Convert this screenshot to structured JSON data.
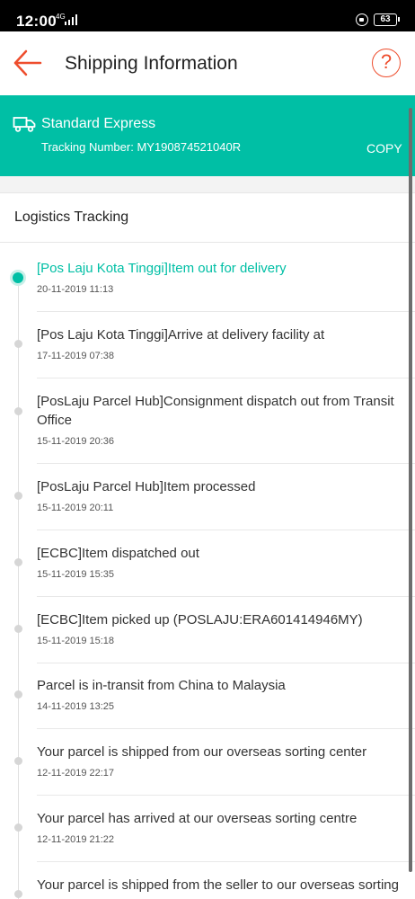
{
  "status_bar": {
    "time": "12:00",
    "network": "4G",
    "battery": "63"
  },
  "header": {
    "title": "Shipping Information",
    "back_icon": "arrow-left-icon",
    "help_icon": "question-icon",
    "help_label": "?"
  },
  "shipping": {
    "carrier": "Standard Express",
    "tracking_number": "Tracking Number: MY190874521040R",
    "copy_label": "COPY",
    "accent_color": "#00bfa5"
  },
  "logistics": {
    "title": "Logistics Tracking",
    "events": [
      {
        "description": "[Pos Laju Kota Tinggi]Item out for delivery",
        "time": "20-11-2019 11:13"
      },
      {
        "description": "[Pos Laju Kota Tinggi]Arrive at delivery facility at",
        "time": "17-11-2019 07:38"
      },
      {
        "description": "[PosLaju Parcel Hub]Consignment dispatch out from Transit Office",
        "time": "15-11-2019 20:36"
      },
      {
        "description": "[PosLaju Parcel Hub]Item processed",
        "time": "15-11-2019 20:11"
      },
      {
        "description": "[ECBC]Item dispatched out",
        "time": "15-11-2019 15:35"
      },
      {
        "description": "[ECBC]Item picked up (POSLAJU:ERA601414946MY)",
        "time": "15-11-2019 15:18"
      },
      {
        "description": "Parcel is in-transit from China to Malaysia",
        "time": "14-11-2019 13:25"
      },
      {
        "description": "Your parcel is shipped from our overseas sorting center",
        "time": "12-11-2019 22:17"
      },
      {
        "description": "Your parcel has arrived at our overseas sorting centre",
        "time": "12-11-2019 21:22"
      },
      {
        "description": "Your parcel is shipped from the seller to our overseas sorting",
        "time": ""
      }
    ]
  }
}
